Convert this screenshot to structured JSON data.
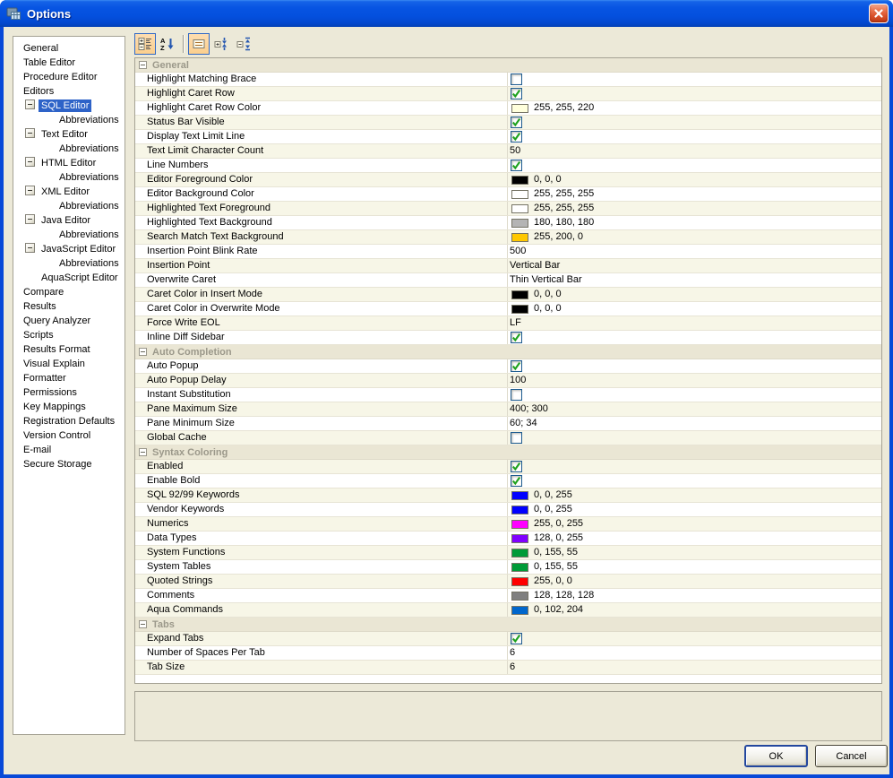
{
  "window": {
    "title": "Options"
  },
  "colors": {
    "selection": "#2E63C8",
    "toolbar_pressed": "#FBCF8E",
    "row_alt": "#F7F6E7"
  },
  "sidebar": {
    "items": [
      {
        "label": "General",
        "level": 0
      },
      {
        "label": "Table Editor",
        "level": 0
      },
      {
        "label": "Procedure Editor",
        "level": 0
      },
      {
        "label": "Editors",
        "level": 0
      },
      {
        "label": "SQL Editor",
        "level": 1,
        "expander": true,
        "selected": true
      },
      {
        "label": "Abbreviations",
        "level": 2
      },
      {
        "label": "Text Editor",
        "level": 1,
        "expander": true
      },
      {
        "label": "Abbreviations",
        "level": 2
      },
      {
        "label": "HTML Editor",
        "level": 1,
        "expander": true
      },
      {
        "label": "Abbreviations",
        "level": 2
      },
      {
        "label": "XML Editor",
        "level": 1,
        "expander": true
      },
      {
        "label": "Abbreviations",
        "level": 2
      },
      {
        "label": "Java Editor",
        "level": 1,
        "expander": true
      },
      {
        "label": "Abbreviations",
        "level": 2
      },
      {
        "label": "JavaScript Editor",
        "level": 1,
        "expander": true
      },
      {
        "label": "Abbreviations",
        "level": 2
      },
      {
        "label": "AquaScript Editor",
        "level": 1
      },
      {
        "label": "Compare",
        "level": 0
      },
      {
        "label": "Results",
        "level": 0
      },
      {
        "label": "Query Analyzer",
        "level": 0
      },
      {
        "label": "Scripts",
        "level": 0
      },
      {
        "label": "Results Format",
        "level": 0
      },
      {
        "label": "Visual Explain",
        "level": 0
      },
      {
        "label": "Formatter",
        "level": 0
      },
      {
        "label": "Permissions",
        "level": 0
      },
      {
        "label": "Key Mappings",
        "level": 0
      },
      {
        "label": "Registration Defaults",
        "level": 0
      },
      {
        "label": "Version Control",
        "level": 0
      },
      {
        "label": "E-mail",
        "level": 0
      },
      {
        "label": "Secure Storage",
        "level": 0
      }
    ]
  },
  "toolbar": {
    "buttons": [
      {
        "icon": "categorized-view-icon",
        "pressed": true
      },
      {
        "icon": "sort-alphabetical-icon",
        "pressed": false
      },
      {
        "icon": "separator"
      },
      {
        "icon": "show-description-icon",
        "pressed": true
      },
      {
        "icon": "expand-all-icon",
        "pressed": false
      },
      {
        "icon": "collapse-all-icon",
        "pressed": false
      }
    ]
  },
  "grid": {
    "sections": [
      {
        "title": "General",
        "rows": [
          {
            "label": "Highlight Matching Brace",
            "type": "checkbox",
            "checked": false
          },
          {
            "label": "Highlight Caret Row",
            "type": "checkbox",
            "checked": true
          },
          {
            "label": "Highlight Caret Row Color",
            "type": "color",
            "swatch": "#FFFFDC",
            "value": "255, 255, 220"
          },
          {
            "label": "Status Bar Visible",
            "type": "checkbox",
            "checked": true
          },
          {
            "label": "Display Text Limit Line",
            "type": "checkbox",
            "checked": true
          },
          {
            "label": "Text Limit Character Count",
            "type": "text",
            "value": "50"
          },
          {
            "label": "Line Numbers",
            "type": "checkbox",
            "checked": true
          },
          {
            "label": "Editor Foreground Color",
            "type": "color",
            "swatch": "#000000",
            "value": "0, 0, 0"
          },
          {
            "label": "Editor Background Color",
            "type": "color",
            "swatch": "#FFFFFF",
            "value": "255, 255, 255"
          },
          {
            "label": "Highlighted Text Foreground",
            "type": "color",
            "swatch": "#FFFFFF",
            "value": "255, 255, 255"
          },
          {
            "label": "Highlighted Text Background",
            "type": "color",
            "swatch": "#B4B4B4",
            "value": "180, 180, 180"
          },
          {
            "label": "Search Match Text Background",
            "type": "color",
            "swatch": "#FFC800",
            "value": "255, 200, 0"
          },
          {
            "label": "Insertion Point Blink Rate",
            "type": "text",
            "value": "500"
          },
          {
            "label": "Insertion Point",
            "type": "text",
            "value": "Vertical Bar"
          },
          {
            "label": "Overwrite Caret",
            "type": "text",
            "value": "Thin Vertical Bar"
          },
          {
            "label": "Caret Color in Insert Mode",
            "type": "color",
            "swatch": "#000000",
            "value": "0, 0, 0"
          },
          {
            "label": "Caret Color in Overwrite Mode",
            "type": "color",
            "swatch": "#000000",
            "value": "0, 0, 0"
          },
          {
            "label": "Force Write EOL",
            "type": "text",
            "value": "LF"
          },
          {
            "label": "Inline Diff Sidebar",
            "type": "checkbox",
            "checked": true
          }
        ]
      },
      {
        "title": "Auto Completion",
        "rows": [
          {
            "label": "Auto Popup",
            "type": "checkbox",
            "checked": true
          },
          {
            "label": "Auto Popup Delay",
            "type": "text",
            "value": "100"
          },
          {
            "label": "Instant Substitution",
            "type": "checkbox",
            "checked": false
          },
          {
            "label": "Pane Maximum Size",
            "type": "text",
            "value": "400; 300"
          },
          {
            "label": "Pane Minimum Size",
            "type": "text",
            "value": "60; 34"
          },
          {
            "label": "Global Cache",
            "type": "checkbox",
            "checked": false
          }
        ]
      },
      {
        "title": "Syntax Coloring",
        "rows": [
          {
            "label": "Enabled",
            "type": "checkbox",
            "checked": true
          },
          {
            "label": "Enable Bold",
            "type": "checkbox",
            "checked": true
          },
          {
            "label": "SQL 92/99 Keywords",
            "type": "color",
            "swatch": "#0000FF",
            "value": "0, 0, 255"
          },
          {
            "label": "Vendor Keywords",
            "type": "color",
            "swatch": "#0000FF",
            "value": "0, 0, 255"
          },
          {
            "label": "Numerics",
            "type": "color",
            "swatch": "#FF00FF",
            "value": "255, 0, 255"
          },
          {
            "label": "Data Types",
            "type": "color",
            "swatch": "#8000FF",
            "value": "128, 0, 255"
          },
          {
            "label": "System Functions",
            "type": "color",
            "swatch": "#009B37",
            "value": "0, 155, 55"
          },
          {
            "label": "System Tables",
            "type": "color",
            "swatch": "#009B37",
            "value": "0, 155, 55"
          },
          {
            "label": "Quoted Strings",
            "type": "color",
            "swatch": "#FF0000",
            "value": "255, 0, 0"
          },
          {
            "label": "Comments",
            "type": "color",
            "swatch": "#808080",
            "value": "128, 128, 128"
          },
          {
            "label": "Aqua Commands",
            "type": "color",
            "swatch": "#0066CC",
            "value": "0, 102, 204"
          }
        ]
      },
      {
        "title": "Tabs",
        "rows": [
          {
            "label": "Expand Tabs",
            "type": "checkbox",
            "checked": true
          },
          {
            "label": "Number of Spaces Per Tab",
            "type": "text",
            "value": "6"
          },
          {
            "label": "Tab Size",
            "type": "text",
            "value": "6"
          }
        ]
      }
    ]
  },
  "footer": {
    "ok": "OK",
    "cancel": "Cancel"
  }
}
